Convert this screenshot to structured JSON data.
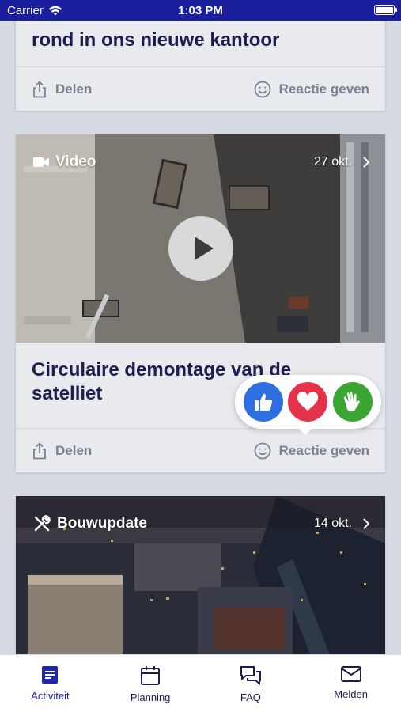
{
  "status_bar": {
    "carrier": "Carrier",
    "time": "1:03 PM"
  },
  "colors": {
    "brand": "#1a1f9e",
    "title": "#1f1d4f",
    "muted": "#7a8292",
    "like": "#2d6fe0",
    "love": "#e5324b",
    "clap": "#3aa531"
  },
  "cards": [
    {
      "title": "rond in ons nieuwe kantoor",
      "share_label": "Delen",
      "react_label": "Reactie geven"
    },
    {
      "type_icon": "video-icon",
      "type_label": "Video",
      "date": "27 okt.",
      "title": "Circulaire demontage van de satelliet",
      "share_label": "Delen",
      "react_label": "Reactie geven"
    },
    {
      "type_icon": "tools-icon",
      "type_label": "Bouwupdate",
      "date": "14 okt."
    }
  ],
  "reactions": [
    "like-icon",
    "heart-icon",
    "clap-icon"
  ],
  "tabs": [
    {
      "label": "Activiteit",
      "icon": "activity-icon",
      "active": true
    },
    {
      "label": "Planning",
      "icon": "calendar-icon",
      "active": false
    },
    {
      "label": "FAQ",
      "icon": "chat-icon",
      "active": false
    },
    {
      "label": "Melden",
      "icon": "mail-icon",
      "active": false
    }
  ]
}
